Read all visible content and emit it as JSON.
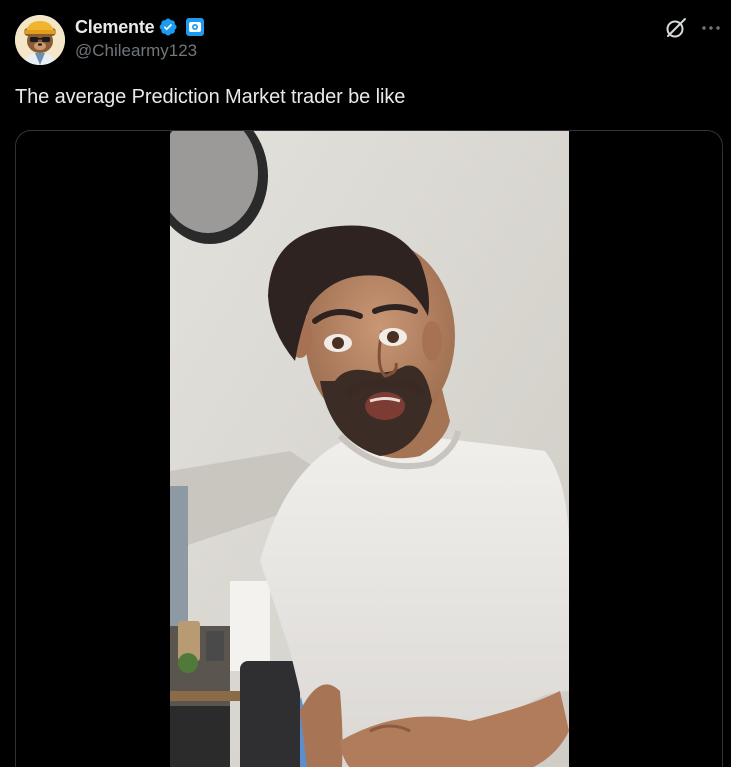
{
  "author": {
    "display_name": "Clemente",
    "handle": "@Chilearmy123",
    "avatar_icon": "bear-avatar-icon",
    "verified_icon": "verified-badge-icon",
    "affiliate_icon": "affiliate-badge-icon"
  },
  "actions": {
    "grok_icon": "grok-icon",
    "more_icon": "more-options-icon"
  },
  "tweet": {
    "text": "The average Prediction Market trader be like"
  },
  "media": {
    "type": "video"
  },
  "colors": {
    "background": "#000000",
    "text_primary": "#e7e9ea",
    "text_secondary": "#71767b",
    "verified_blue": "#1d9bf0",
    "border": "#2f3336"
  }
}
